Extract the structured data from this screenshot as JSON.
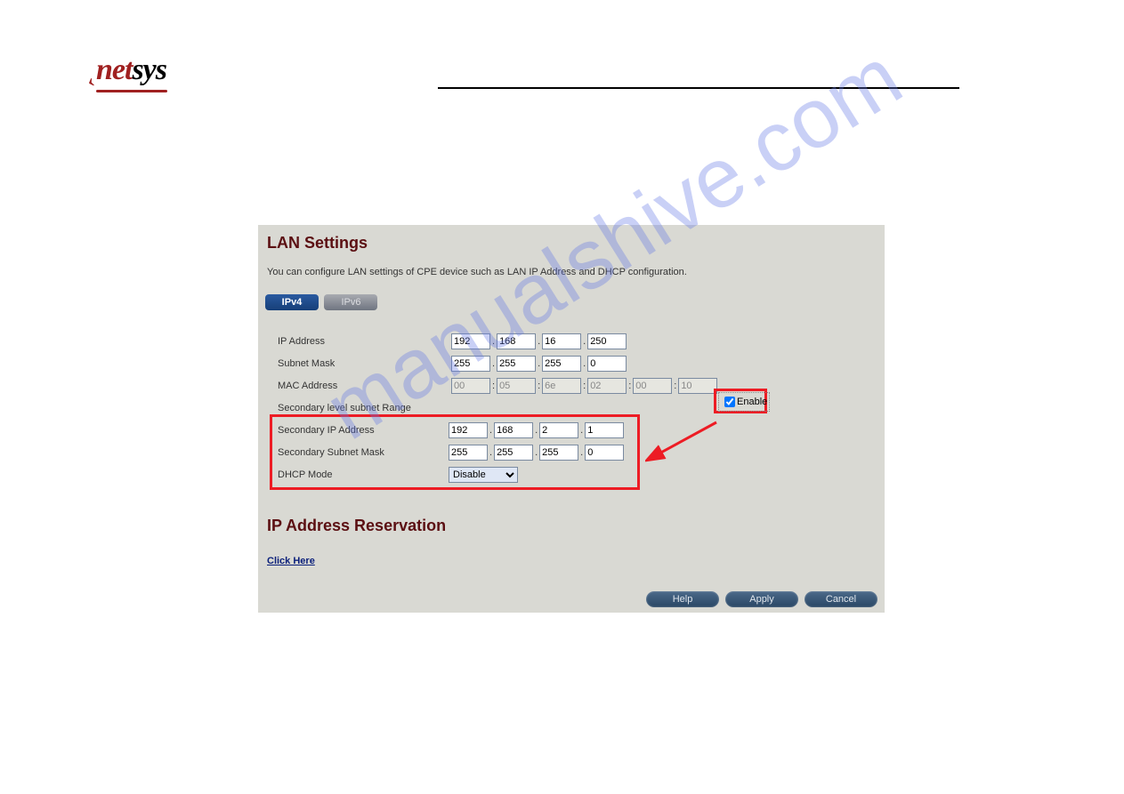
{
  "logo": {
    "brand_red": "net",
    "brand_black": "sys"
  },
  "watermark": "manualshive.com",
  "panel": {
    "title": "LAN Settings",
    "description": "You can configure LAN settings of CPE device such as LAN IP Address and DHCP configuration."
  },
  "tabs": {
    "ipv4": "IPv4",
    "ipv6": "IPv6"
  },
  "fields": {
    "ip_address_label": "IP Address",
    "ip_address": [
      "192",
      "168",
      "16",
      "250"
    ],
    "subnet_mask_label": "Subnet Mask",
    "subnet_mask": [
      "255",
      "255",
      "255",
      "0"
    ],
    "mac_address_label": "MAC Address",
    "mac_address": [
      "00",
      "05",
      "6e",
      "02",
      "00",
      "10"
    ],
    "secondary_range_label": "Secondary level subnet Range",
    "enable_label": "Enable",
    "secondary_ip_label": "Secondary IP Address",
    "secondary_ip": [
      "192",
      "168",
      "2",
      "1"
    ],
    "secondary_mask_label": "Secondary Subnet Mask",
    "secondary_mask": [
      "255",
      "255",
      "255",
      "0"
    ],
    "dhcp_mode_label": "DHCP Mode",
    "dhcp_mode_value": "Disable"
  },
  "reservation": {
    "title": "IP Address Reservation",
    "link": "Click Here"
  },
  "buttons": {
    "help": "Help",
    "apply": "Apply",
    "cancel": "Cancel"
  }
}
